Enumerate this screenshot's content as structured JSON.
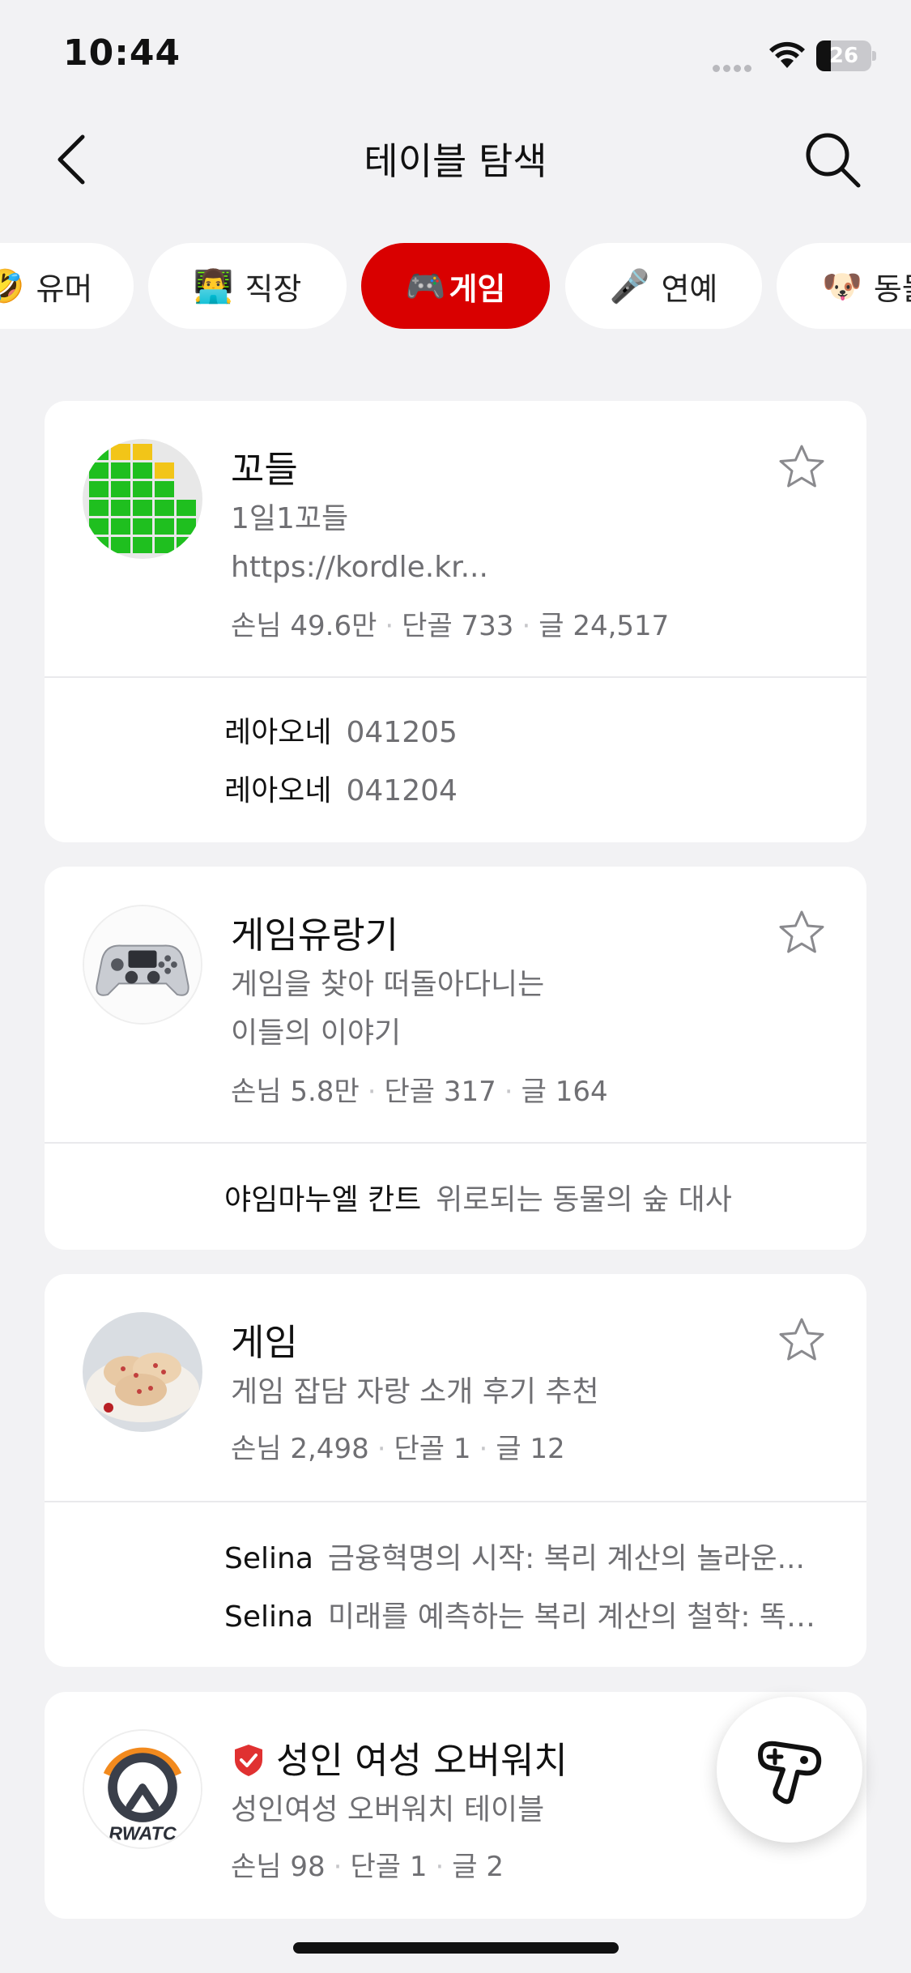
{
  "status_bar": {
    "time": "10:44",
    "battery_level": "26",
    "battery_fraction": 0.26
  },
  "nav": {
    "title": "테이블 탐색"
  },
  "categories": [
    {
      "emoji": "🤣",
      "label": "유머",
      "active": false
    },
    {
      "emoji": "👨‍💻",
      "label": "직장",
      "active": false
    },
    {
      "emoji": "🎮",
      "label": "게임",
      "active": true
    },
    {
      "emoji": "🎤",
      "label": "연예",
      "active": false
    },
    {
      "emoji": "🐶",
      "label": "동물",
      "active": false
    }
  ],
  "tables": [
    {
      "name": "꼬들",
      "description_lines": [
        "1일1꼬들",
        "https://kordle.kr..."
      ],
      "stats": {
        "guests": "손님 49.6만",
        "regulars": "단골 733",
        "posts": "글 24,517"
      },
      "recent_posts": [
        {
          "author": "레아오네",
          "title": "041205"
        },
        {
          "author": "레아오네",
          "title": "041204"
        }
      ]
    },
    {
      "name": "게임유랑기",
      "description_lines": [
        "게임을 찾아 떠돌아다니는",
        "이들의 이야기"
      ],
      "stats": {
        "guests": "손님 5.8만",
        "regulars": "단골 317",
        "posts": "글 164"
      },
      "recent_posts": [
        {
          "author": "야임마누엘 칸트",
          "title": "위로되는 동물의 숲 대사"
        }
      ]
    },
    {
      "name": "게임",
      "description_lines": [
        "게임 잡담 자랑 소개 후기 추천"
      ],
      "stats": {
        "guests": "손님 2,498",
        "regulars": "단골 1",
        "posts": "글 12"
      },
      "recent_posts": [
        {
          "author": "Selina",
          "title": "금융혁명의 시작: 복리 계산의 놀라운..."
        },
        {
          "author": "Selina",
          "title": "미래를 예측하는 복리 계산의 철학: 똑…"
        }
      ]
    },
    {
      "name": "성인 여성 오버워치",
      "logo_text": "RWATC",
      "description_lines": [
        "성인여성 오버워치 테이블"
      ],
      "stats": {
        "guests": "손님 98",
        "regulars": "단골 1",
        "posts": "글 2"
      },
      "recent_posts": []
    }
  ],
  "colors": {
    "accent": "#d90000",
    "background": "#f2f2f4",
    "muted_text": "#6f6f73"
  }
}
